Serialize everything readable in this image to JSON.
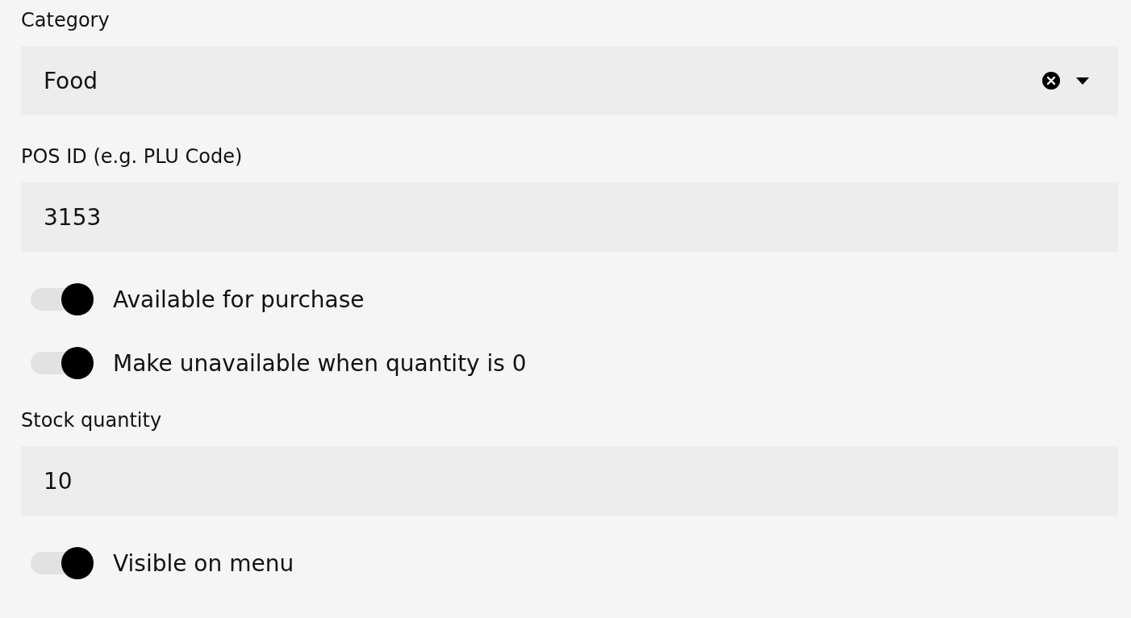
{
  "fields": [
    {
      "kind": "select",
      "label": "Category",
      "value": "Food",
      "clearable": true
    },
    {
      "kind": "input",
      "label": "POS ID (e.g. PLU Code)",
      "value": "3153"
    },
    {
      "kind": "toggle",
      "label": "Available for purchase",
      "on": true
    },
    {
      "kind": "toggle",
      "label": "Make unavailable when quantity is 0",
      "on": true
    },
    {
      "kind": "input",
      "label": "Stock quantity",
      "value": "10"
    },
    {
      "kind": "toggle",
      "label": "Visible on menu",
      "on": true
    }
  ]
}
